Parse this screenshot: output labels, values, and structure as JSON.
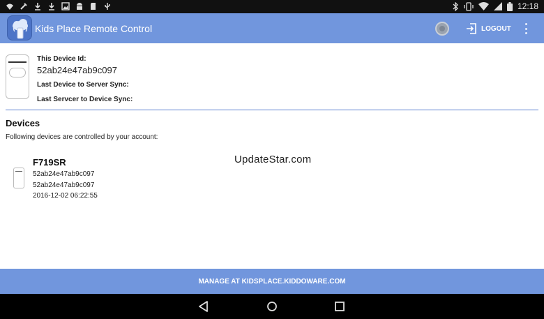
{
  "status_bar": {
    "time": "12:18",
    "left_icons": [
      "wifi-plus-icon",
      "tools-icon",
      "download-icon",
      "download-icon",
      "image-icon",
      "android-icon",
      "sd-card-icon",
      "usb-icon"
    ],
    "right_icons": [
      "bluetooth-icon",
      "vibrate-icon",
      "wifi-icon",
      "signal-icon",
      "battery-icon"
    ]
  },
  "app_bar": {
    "title": "Kids Place Remote Control",
    "logout_label": "LOGOUT",
    "logo_icon": "cloud-phone-icon",
    "color": "#7196dd"
  },
  "device_info": {
    "device_id_label": "This Device Id:",
    "device_id_value": "52ab24e47ab9c097",
    "last_device_to_server_label": "Last Device to Server Sync:",
    "last_server_to_device_label": "Last Servcer to Device Sync:"
  },
  "devices": {
    "title": "Devices",
    "subtitle": "Following devices are controlled by your account:",
    "items": [
      {
        "name": "F719SR",
        "line1": "52ab24e47ab9c097",
        "line2": "52ab24e47ab9c097",
        "timestamp": "2016-12-02 06:22:55"
      }
    ]
  },
  "watermark": "UpdateStar.com",
  "bottom_bar": {
    "link_label": "MANAGE AT KIDSPLACE.KIDDOWARE.COM"
  },
  "nav_bar": {
    "icons": [
      "back-icon",
      "home-icon",
      "recents-icon"
    ]
  }
}
